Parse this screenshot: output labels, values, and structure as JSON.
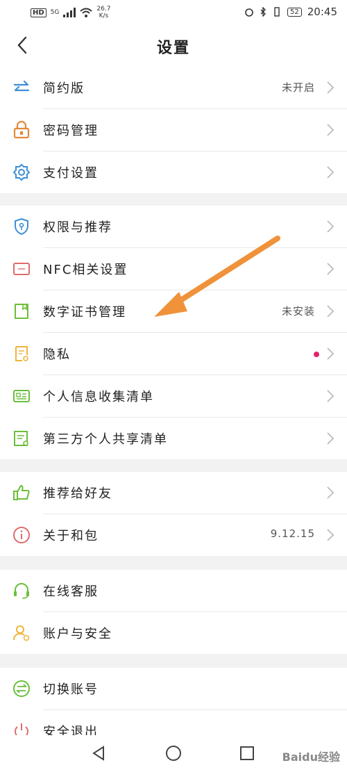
{
  "status_bar": {
    "hd": "HD",
    "signal": "5G",
    "speed_top": "26.7",
    "speed_unit": "K/s",
    "battery": "52",
    "time": "20:45"
  },
  "header": {
    "title": "设置"
  },
  "groups": [
    [
      {
        "label": "简约版",
        "value": "未开启"
      },
      {
        "label": "密码管理"
      },
      {
        "label": "支付设置"
      }
    ],
    [
      {
        "label": "权限与推荐"
      },
      {
        "label": "NFC相关设置"
      },
      {
        "label": "数字证书管理",
        "value": "未安装"
      },
      {
        "label": "隐私"
      },
      {
        "label": "个人信息收集清单"
      },
      {
        "label": "第三方个人共享清单"
      }
    ],
    [
      {
        "label": "推荐给好友"
      },
      {
        "label": "关于和包",
        "value": "9.12.15"
      }
    ],
    [
      {
        "label": "在线客服"
      },
      {
        "label": "账户与安全"
      }
    ],
    [
      {
        "label": "切换账号"
      },
      {
        "label": "安全退出"
      }
    ]
  ],
  "watermark": "Baidu经验",
  "colors": {
    "accent": "#2aa198",
    "orange": "#f0923a",
    "green": "#6bbf3b",
    "red": "#e06b6b",
    "blue": "#3c8fd6",
    "dot": "#e0246a"
  },
  "icons": [
    "switch-icon",
    "lock-icon",
    "gear-icon",
    "shield-icon",
    "nfc-icon",
    "certificate-icon",
    "privacy-icon",
    "id-card-icon",
    "list-icon",
    "thumbs-up-icon",
    "info-icon",
    "headset-icon",
    "user-icon",
    "swap-icon",
    "power-icon"
  ]
}
